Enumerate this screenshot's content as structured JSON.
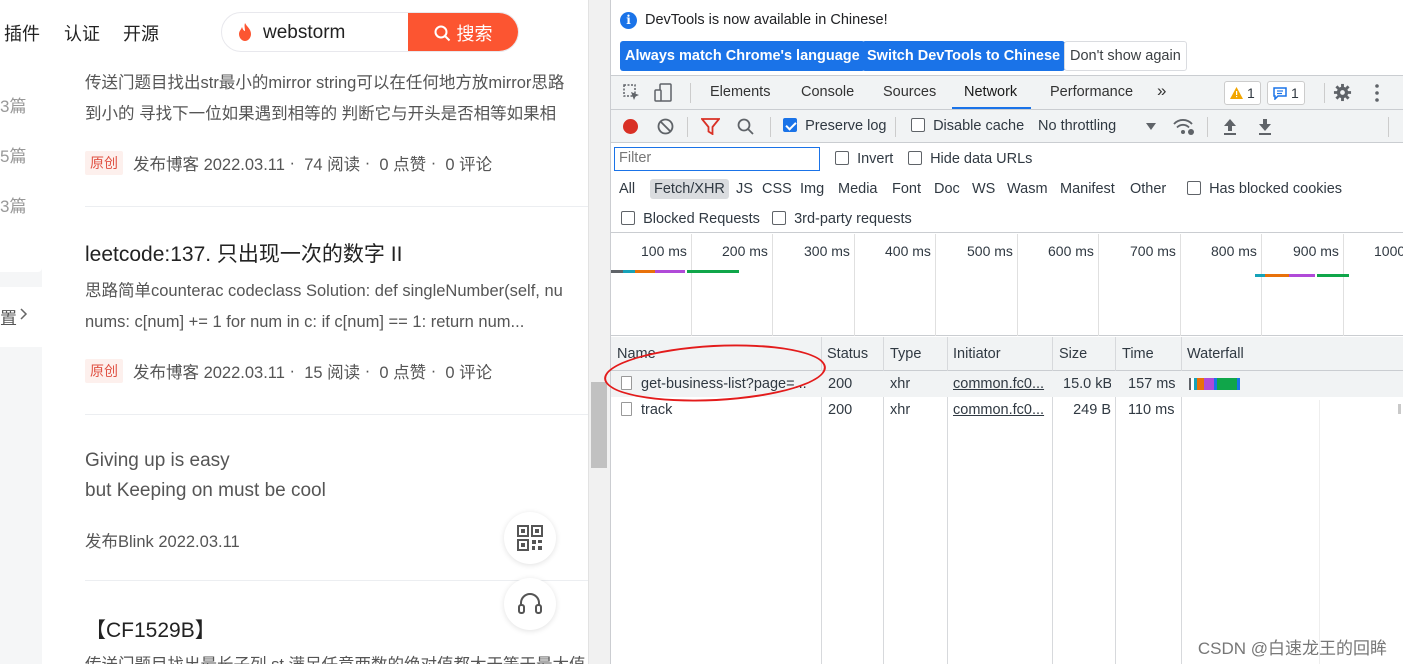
{
  "blog": {
    "nav": [
      "插件",
      "认证",
      "开源"
    ],
    "search": {
      "query": "webstorm",
      "button_label": "搜索"
    },
    "side_counts": [
      "3篇",
      "5篇",
      "3篇"
    ],
    "side_more": "置",
    "items": [
      {
        "desc_lines": [
          "传送门题目找出str最小的mirror string可以在任何地方放mirror思路",
          "到小的 寻找下一位如果遇到相等的 判断它与开头是否相等如果相"
        ],
        "badge": "原创",
        "published": "发布博客 2022.03.11",
        "reads": "74 阅读",
        "likes": "0 点赞",
        "comments": "0 评论"
      },
      {
        "title": "leetcode:137. 只出现一次的数字 II",
        "desc_lines": [
          "思路简单counterac codeclass Solution: def singleNumber(self, nu",
          "nums: c[num] += 1 for num in c: if c[num] == 1: return num..."
        ],
        "badge": "原创",
        "published": "发布博客 2022.03.11",
        "reads": "15 阅读",
        "likes": "0 点赞",
        "comments": "0 评论"
      }
    ],
    "blink": {
      "lines": [
        "Giving up is easy",
        "but Keeping on must be cool"
      ],
      "date": "发布Blink 2022.03.11"
    },
    "last_title": "【CF1529B】",
    "last_desc": "传送门题目找出最长子列 st 满足任意两数的绝对值都大于等于最大值"
  },
  "devtools": {
    "info": {
      "text": "DevTools is now available in Chinese!",
      "btn_match": "Always match Chrome's language",
      "btn_switch": "Switch DevTools to Chinese",
      "btn_dismiss": "Don't show again"
    },
    "tabs": [
      "Elements",
      "Console",
      "Sources",
      "Network",
      "Performance"
    ],
    "active_tab": "Network",
    "warnings": "1",
    "messages": "1",
    "toolbar": {
      "preserve_log": "Preserve log",
      "disable_cache": "Disable cache",
      "throttling": "No throttling"
    },
    "filter": {
      "placeholder": "Filter",
      "invert": "Invert",
      "hide_data_urls": "Hide data URLs",
      "has_blocked_cookies": "Has blocked cookies",
      "blocked_requests": "Blocked Requests",
      "third_party": "3rd-party requests"
    },
    "types": [
      "All",
      "Fetch/XHR",
      "JS",
      "CSS",
      "Img",
      "Media",
      "Font",
      "Doc",
      "WS",
      "Wasm",
      "Manifest",
      "Other"
    ],
    "active_type": "Fetch/XHR",
    "timeline": [
      "100 ms",
      "200 ms",
      "300 ms",
      "400 ms",
      "500 ms",
      "600 ms",
      "700 ms",
      "800 ms",
      "900 ms",
      "1000"
    ],
    "columns": [
      "Name",
      "Status",
      "Type",
      "Initiator",
      "Size",
      "Time",
      "Waterfall"
    ],
    "rows": [
      {
        "name": "get-business-list?page=...",
        "status": "200",
        "type": "xhr",
        "initiator": "common.fc0...",
        "size": "15.0 kB",
        "time": "157 ms"
      },
      {
        "name": "track",
        "status": "200",
        "type": "xhr",
        "initiator": "common.fc0...",
        "size": "249 B",
        "time": "110 ms"
      }
    ]
  },
  "watermark": "CSDN @白速龙王的回眸",
  "colors": {
    "csdn_red": "#fc5531",
    "devtools_blue": "#1a73e8",
    "annotation": "#e31b1b"
  }
}
